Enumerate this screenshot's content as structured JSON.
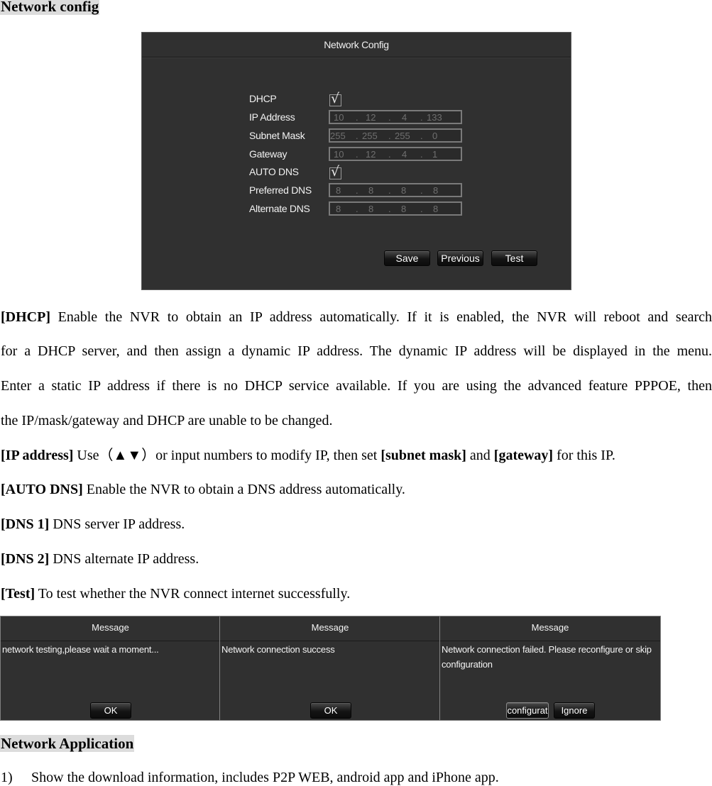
{
  "section1_heading": "Network config",
  "dialog": {
    "title": "Network Config",
    "fields": [
      {
        "label": "DHCP",
        "type": "checkbox",
        "checked": true,
        "glyph": "√"
      },
      {
        "label": "IP Address",
        "type": "ip",
        "octets": [
          "10",
          "12",
          "4",
          "133"
        ]
      },
      {
        "label": "Subnet Mask",
        "type": "ip",
        "octets": [
          "255",
          "255",
          "255",
          "0"
        ]
      },
      {
        "label": "Gateway",
        "type": "ip",
        "octets": [
          "10",
          "12",
          "4",
          "1"
        ]
      },
      {
        "label": "AUTO DNS",
        "type": "checkbox",
        "checked": true,
        "glyph": "√"
      },
      {
        "label": "Preferred DNS",
        "type": "ip",
        "octets": [
          "8",
          "8",
          "8",
          "8"
        ]
      },
      {
        "label": "Alternate DNS",
        "type": "ip",
        "octets": [
          "8",
          "8",
          "8",
          "8"
        ]
      }
    ],
    "buttons": {
      "save": "Save",
      "previous": "Previous",
      "test": "Test"
    },
    "separator": "."
  },
  "descriptions": {
    "dhcp": {
      "term": "[DHCP]",
      "lines": [
        " Enable the NVR to obtain an IP address automatically. If it is enabled, the NVR will reboot and search",
        "for a DHCP server, and then assign a dynamic IP address. The dynamic IP address will be displayed in the menu.",
        "Enter a static IP address if there is no DHCP service available. If you are using the advanced feature PPPOE, then",
        "the IP/mask/gateway and DHCP are unable to be changed."
      ]
    },
    "ip_address": {
      "term": "[IP address]",
      "text1": " Use（▲▼）or input numbers to modify IP, then set ",
      "term2": "[subnet mask]",
      "text2": " and ",
      "term3": "[gateway]",
      "text3": " for this IP."
    },
    "auto_dns": {
      "term": "[AUTO DNS]",
      "text": " Enable the NVR to obtain a DNS address automatically."
    },
    "dns1": {
      "term": "[DNS 1]",
      "text": " DNS server IP address."
    },
    "dns2": {
      "term": "[DNS 2]",
      "text": " DNS alternate IP address."
    },
    "test": {
      "term": "[Test]",
      "text": " To test whether the NVR connect internet successfully."
    }
  },
  "messages": [
    {
      "title": "Message",
      "text": "network testing,please wait a moment...",
      "buttons": [
        "OK"
      ]
    },
    {
      "title": "Message",
      "text": "Network connection success",
      "buttons": [
        "OK"
      ]
    },
    {
      "title": "Message",
      "text": "Network connection failed. Please reconfigure or skip configuration",
      "buttons": [
        "configurat",
        "Ignore"
      ]
    }
  ],
  "section2_heading": "Network Application",
  "list_items": [
    {
      "number": "1)",
      "text": "Show the download information, includes P2P WEB, android app and iPhone app."
    }
  ]
}
